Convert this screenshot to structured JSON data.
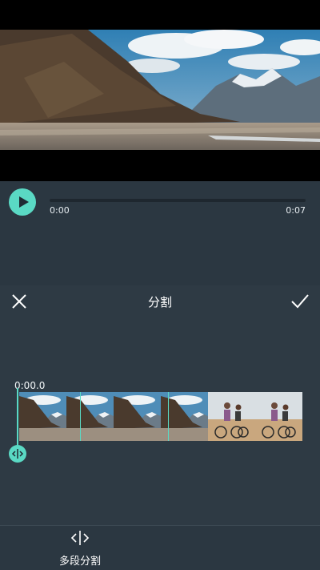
{
  "player": {
    "current_time": "0:00",
    "total_time": "0:07",
    "progress": 0
  },
  "edit": {
    "title": "分割",
    "timecode": "0:00.0"
  },
  "toolbar": {
    "multi_split_label": "多段分割"
  },
  "colors": {
    "accent": "#5ad9c4",
    "panel_bg": "#2e3a44",
    "player_bg": "#2b3741"
  },
  "icons": {
    "play": "play-icon",
    "close": "close-icon",
    "confirm": "check-icon",
    "split": "split-icon",
    "handle": "split-handle-icon"
  }
}
